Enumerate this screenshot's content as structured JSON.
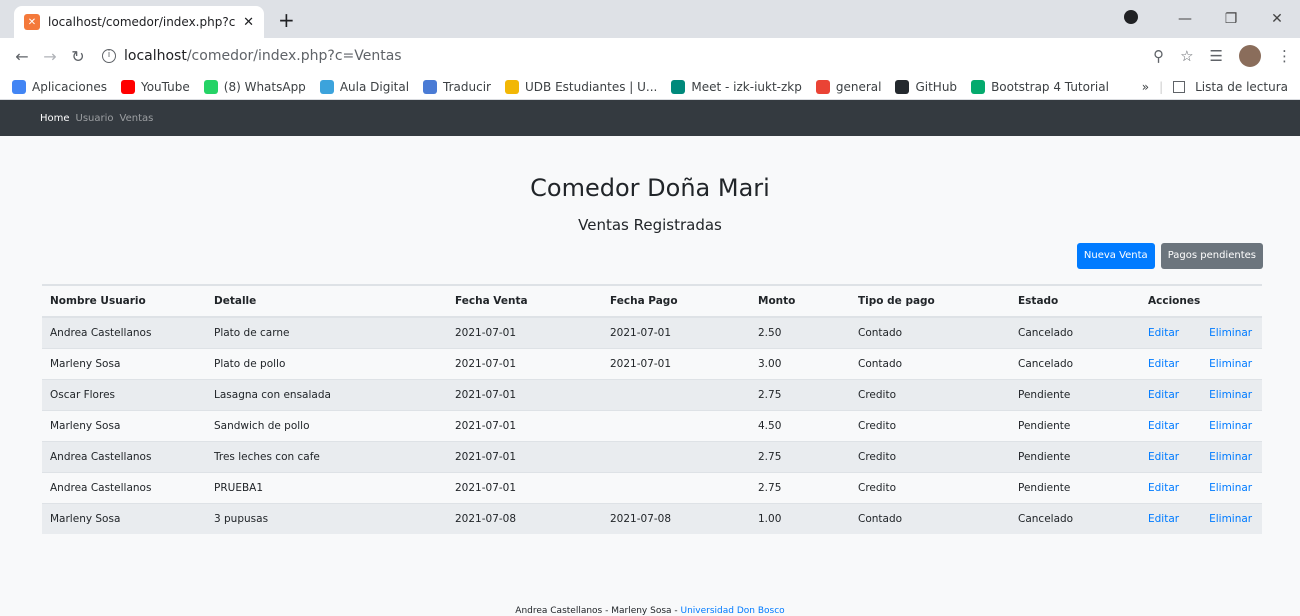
{
  "browser": {
    "tab_title": "localhost/comedor/index.php?c=",
    "tab_close": "✕",
    "new_tab": "+",
    "url_host": "localhost",
    "url_path": "/comedor/index.php?c=Ventas",
    "bookmarks": [
      {
        "label": "Aplicaciones",
        "color": "#4285f4"
      },
      {
        "label": "YouTube",
        "color": "#ff0000"
      },
      {
        "label": "(8) WhatsApp",
        "color": "#25d366"
      },
      {
        "label": "Aula Digital",
        "color": "#3ca3dc"
      },
      {
        "label": "Traducir",
        "color": "#4a7bd5"
      },
      {
        "label": "UDB Estudiantes | U...",
        "color": "#f2b705"
      },
      {
        "label": "Meet - izk-iukt-zkp",
        "color": "#00897b"
      },
      {
        "label": "general",
        "color": "#ea4335"
      },
      {
        "label": "GitHub",
        "color": "#24292e"
      },
      {
        "label": "Bootstrap 4 Tutorial",
        "color": "#04aa6d"
      }
    ],
    "bookmarks_more": "»",
    "reading_list": "Lista de lectura"
  },
  "nav": {
    "home": "Home",
    "usuario": "Usuario",
    "ventas": "Ventas"
  },
  "page": {
    "title": "Comedor Doña Mari",
    "subtitle": "Ventas Registradas",
    "new_sale_button": "Nueva Venta",
    "pending_button": "Pagos pendientes"
  },
  "table": {
    "headers": [
      "Nombre Usuario",
      "Detalle",
      "Fecha Venta",
      "Fecha Pago",
      "Monto",
      "Tipo de pago",
      "Estado",
      "Acciones"
    ],
    "rows": [
      {
        "usuario": "Andrea Castellanos",
        "detalle": "Plato de carne",
        "fecha_venta": "2021-07-01",
        "fecha_pago": "2021-07-01",
        "monto": "2.50",
        "tipo": "Contado",
        "estado": "Cancelado"
      },
      {
        "usuario": "Marleny Sosa",
        "detalle": "Plato de pollo",
        "fecha_venta": "2021-07-01",
        "fecha_pago": "2021-07-01",
        "monto": "3.00",
        "tipo": "Contado",
        "estado": "Cancelado"
      },
      {
        "usuario": "Oscar Flores",
        "detalle": "Lasagna con ensalada",
        "fecha_venta": "2021-07-01",
        "fecha_pago": "",
        "monto": "2.75",
        "tipo": "Credito",
        "estado": "Pendiente"
      },
      {
        "usuario": "Marleny Sosa",
        "detalle": "Sandwich de pollo",
        "fecha_venta": "2021-07-01",
        "fecha_pago": "",
        "monto": "4.50",
        "tipo": "Credito",
        "estado": "Pendiente"
      },
      {
        "usuario": "Andrea Castellanos",
        "detalle": "Tres leches con cafe",
        "fecha_venta": "2021-07-01",
        "fecha_pago": "",
        "monto": "2.75",
        "tipo": "Credito",
        "estado": "Pendiente"
      },
      {
        "usuario": "Andrea Castellanos",
        "detalle": "PRUEBA1",
        "fecha_venta": "2021-07-01",
        "fecha_pago": "",
        "monto": "2.75",
        "tipo": "Credito",
        "estado": "Pendiente"
      },
      {
        "usuario": "Marleny Sosa",
        "detalle": "3 pupusas",
        "fecha_venta": "2021-07-08",
        "fecha_pago": "2021-07-08",
        "monto": "1.00",
        "tipo": "Contado",
        "estado": "Cancelado"
      }
    ],
    "edit_label": "Editar",
    "delete_label": "Eliminar"
  },
  "footer": {
    "text": "Andrea Castellanos - Marleny Sosa - ",
    "link": "Universidad Don Bosco"
  }
}
